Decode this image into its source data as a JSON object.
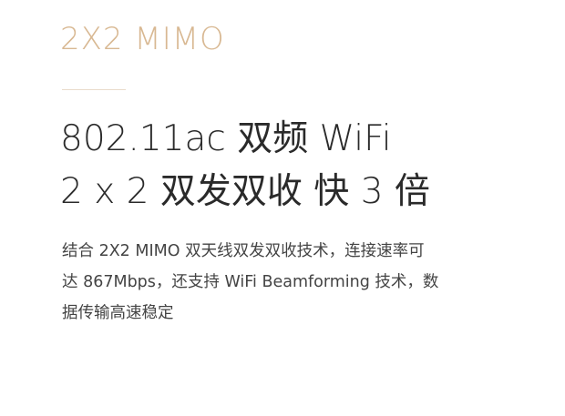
{
  "eyebrow": "2X2 MIMO",
  "headline": {
    "line1": "802.11ac 双频 WiFi",
    "line2": "2 x 2 双发双收 快 3 倍"
  },
  "body": {
    "line1": "结合 2X2 MIMO 双天线双发双收技术，连接速率可",
    "line2": "达 867Mbps，还支持 WiFi Beamforming 技术，数",
    "line3": "据传输高速稳定"
  },
  "colors": {
    "accent": "#d8b892",
    "headline": "#2a2a2a",
    "body": "#444444",
    "background": "#ffffff"
  }
}
